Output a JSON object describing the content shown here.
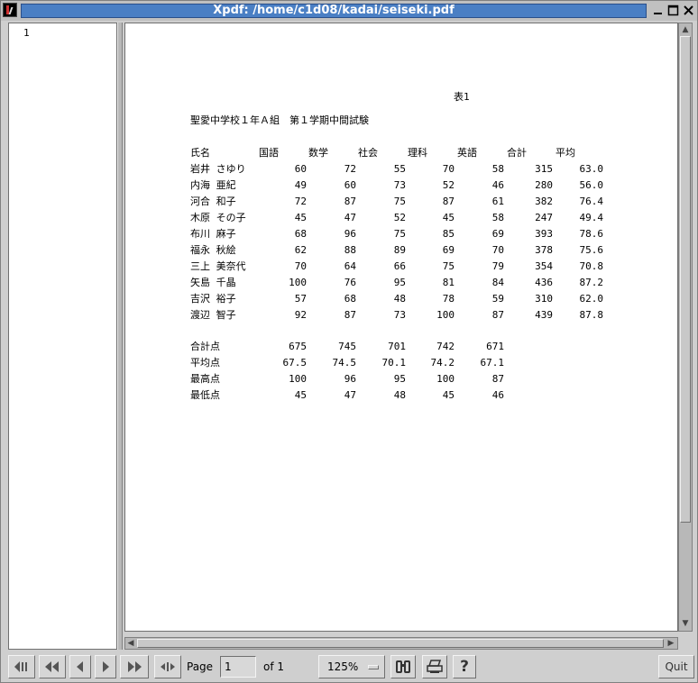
{
  "window": {
    "title": "Xpdf: /home/c1d08/kadai/seiseki.pdf",
    "controls": [
      "minimize-icon",
      "maximize-icon",
      "close-icon"
    ]
  },
  "sidebar": {
    "pages": [
      "1"
    ]
  },
  "document": {
    "caption": "表1",
    "subtitle": "聖愛中学校１年Ａ組　第１学期中間試験",
    "headers": [
      "氏名",
      "国語",
      "数学",
      "社会",
      "理科",
      "英語",
      "合計",
      "平均"
    ],
    "students": [
      {
        "name": "岩井 さゆり",
        "scores": [
          "60",
          "72",
          "55",
          "70",
          "58"
        ],
        "total": "315",
        "avg": "63.0"
      },
      {
        "name": "内海 亜紀",
        "scores": [
          "49",
          "60",
          "73",
          "52",
          "46"
        ],
        "total": "280",
        "avg": "56.0"
      },
      {
        "name": "河合 和子",
        "scores": [
          "72",
          "87",
          "75",
          "87",
          "61"
        ],
        "total": "382",
        "avg": "76.4"
      },
      {
        "name": "木原 その子",
        "scores": [
          "45",
          "47",
          "52",
          "45",
          "58"
        ],
        "total": "247",
        "avg": "49.4"
      },
      {
        "name": "布川 麻子",
        "scores": [
          "68",
          "96",
          "75",
          "85",
          "69"
        ],
        "total": "393",
        "avg": "78.6"
      },
      {
        "name": "福永 秋絵",
        "scores": [
          "62",
          "88",
          "89",
          "69",
          "70"
        ],
        "total": "378",
        "avg": "75.6"
      },
      {
        "name": "三上 美奈代",
        "scores": [
          "70",
          "64",
          "66",
          "75",
          "79"
        ],
        "total": "354",
        "avg": "70.8"
      },
      {
        "name": "矢島 千晶",
        "scores": [
          "100",
          "76",
          "95",
          "81",
          "84"
        ],
        "total": "436",
        "avg": "87.2"
      },
      {
        "name": "吉沢 裕子",
        "scores": [
          "57",
          "68",
          "48",
          "78",
          "59"
        ],
        "total": "310",
        "avg": "62.0"
      },
      {
        "name": "渡辺 智子",
        "scores": [
          "92",
          "87",
          "73",
          "100",
          "87"
        ],
        "total": "439",
        "avg": "87.8"
      }
    ],
    "summary": [
      {
        "label": "合計点",
        "values": [
          "675",
          "745",
          "701",
          "742",
          "671"
        ]
      },
      {
        "label": "平均点",
        "values": [
          "67.5",
          "74.5",
          "70.1",
          "74.2",
          "67.1"
        ]
      },
      {
        "label": "最高点",
        "values": [
          "100",
          "96",
          "95",
          "100",
          "87"
        ]
      },
      {
        "label": "最低点",
        "values": [
          "45",
          "47",
          "48",
          "45",
          "46"
        ]
      }
    ]
  },
  "toolbar": {
    "buttons": [
      "first-page-icon",
      "back-10-icon",
      "prev-page-icon",
      "next-page-icon",
      "forward-10-icon",
      "back-forward-icon",
      "find-icon",
      "print-icon",
      "help-icon"
    ],
    "page_label": "Page",
    "page_value": "1",
    "page_of": "of 1",
    "zoom": "125%",
    "help_glyph": "?",
    "quit_label": "Quit"
  }
}
